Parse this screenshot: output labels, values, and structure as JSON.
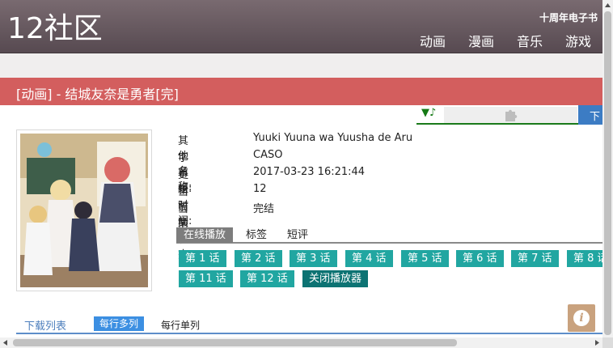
{
  "header": {
    "logo": "12社区",
    "ebook_link": "十周年电子书",
    "nav": [
      "动画",
      "漫画",
      "音乐",
      "游戏"
    ]
  },
  "title_bar": {
    "title": "[动画] - 结城友奈是勇者[完]"
  },
  "player": {
    "note_glyph": "▼♪",
    "download_label": "下"
  },
  "info": {
    "rows": [
      {
        "key": "其他名称:",
        "value": "Yuuki Yuuna wa Yuusha de Aru"
      },
      {
        "key": "字幕组:",
        "value": "CASO"
      },
      {
        "key": "更新时间:",
        "value": "2017-03-23 16:21:44"
      },
      {
        "key": "当前集数:",
        "value": "12"
      },
      {
        "key": "当前状态:",
        "value": "完结"
      }
    ]
  },
  "tabs": [
    "在线播放",
    "标签",
    "短评"
  ],
  "episodes": [
    "第 1 话",
    "第 2 话",
    "第 3 话",
    "第 4 话",
    "第 5 话",
    "第 6 话",
    "第 7 话",
    "第 8 话",
    "第 11 话",
    "第 12 话"
  ],
  "close_player": "关闭播放器",
  "download_list": {
    "title": "下载列表",
    "multi": "每行多列",
    "single": "每行单列"
  },
  "info_button": "i",
  "colors": {
    "header": "#6a5c63",
    "title_bar": "#d35e5e",
    "episode": "#21a6a1",
    "close_player": "#0d7373",
    "download_tab": "#3c8fe2",
    "info_button": "#c9a27e"
  }
}
